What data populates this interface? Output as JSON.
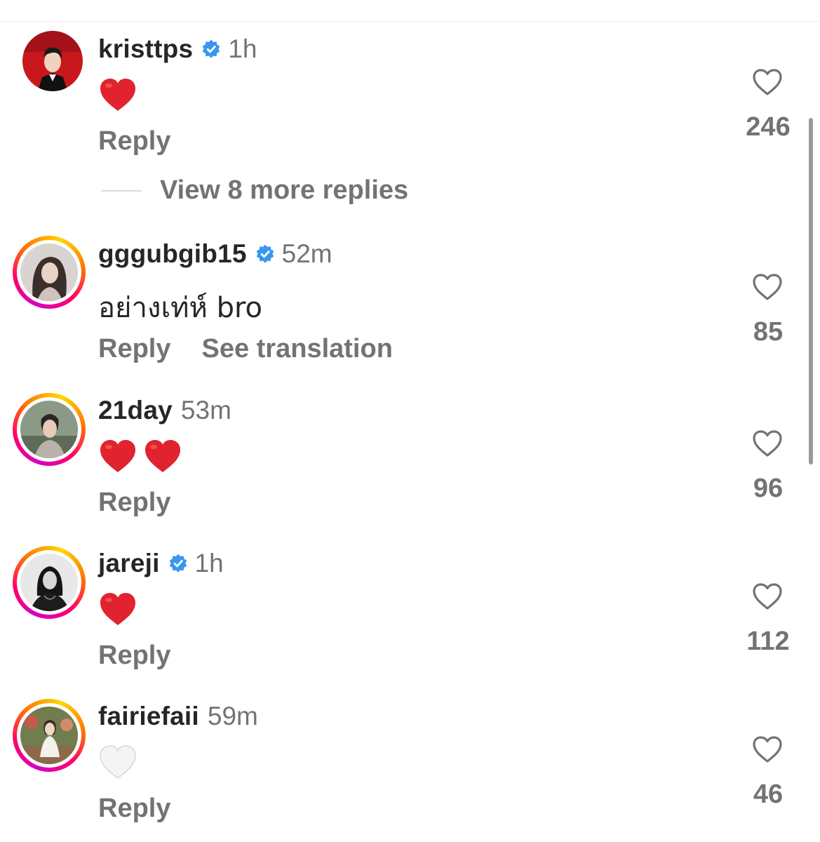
{
  "colors": {
    "username": "#262626",
    "secondary": "#737373",
    "verified": "#3897f0",
    "heart_red": "#e0232f",
    "story_ring": [
      "#d300c5",
      "#ff0069",
      "#ff7a00",
      "#ffd600"
    ]
  },
  "view_more_replies": "View 8 more replies",
  "comments": [
    {
      "username": "kristtps",
      "verified": true,
      "time": "1h",
      "content": "red-heart-emoji",
      "reply_label": "Reply",
      "likes": "246"
    },
    {
      "username": "gggubgib15",
      "verified": true,
      "time": "52m",
      "text": "อย่างเท่ห์ bro",
      "reply_label": "Reply",
      "translate_label": "See translation",
      "likes": "85"
    },
    {
      "username": "21day",
      "verified": false,
      "time": "53m",
      "content": "two-red-heart-emojis",
      "reply_label": "Reply",
      "likes": "96"
    },
    {
      "username": "jareji",
      "verified": true,
      "time": "1h",
      "content": "red-heart-emoji",
      "reply_label": "Reply",
      "likes": "112"
    },
    {
      "username": "fairiefaii",
      "verified": false,
      "time": "59m",
      "content": "white-heart-emoji",
      "reply_label": "Reply",
      "likes": "46"
    }
  ]
}
